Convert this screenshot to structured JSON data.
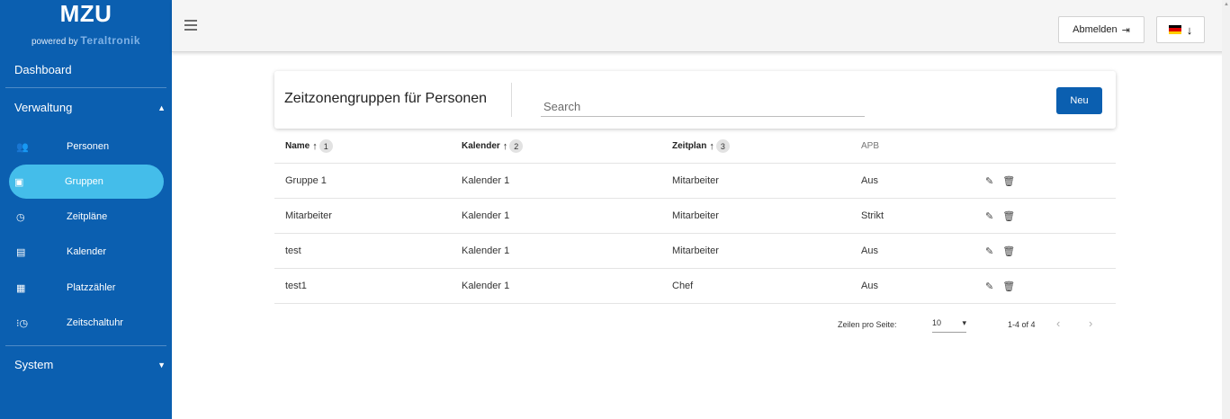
{
  "logo": {
    "title": "MZU",
    "powered_by": "powered by",
    "brand": "Teraltronik"
  },
  "sidebar": {
    "dashboard": "Dashboard",
    "verwaltung": "Verwaltung",
    "items": [
      {
        "label": "Personen",
        "icon": "persons-icon",
        "glyph": "👥"
      },
      {
        "label": "Gruppen",
        "icon": "group-icon",
        "glyph": "▣"
      },
      {
        "label": "Zeitpläne",
        "icon": "clock-icon",
        "glyph": "◷"
      },
      {
        "label": "Kalender",
        "icon": "calendar-icon",
        "glyph": "▤"
      },
      {
        "label": "Platzzähler",
        "icon": "counter-icon",
        "glyph": "▦"
      },
      {
        "label": "Zeitschaltuhr",
        "icon": "timer-icon",
        "glyph": "⁝◷"
      }
    ],
    "system": "System",
    "active_color": "#44bdea",
    "bg_color": "#0b5fb0"
  },
  "topbar": {
    "logout": "Abmelden",
    "logout_icon": "⇥",
    "lang_arrow": "↓"
  },
  "card": {
    "title": "Zeitzonengruppen für Personen",
    "search_placeholder": "Search",
    "new_button": "Neu"
  },
  "table": {
    "headers": [
      "Name",
      "Kalender",
      "Zeitplan",
      "APB"
    ],
    "sort_badges": [
      "1",
      "2",
      "3"
    ],
    "sort_arrow": "↑",
    "rows": [
      {
        "name": "Gruppe 1",
        "kalender": "Kalender 1",
        "zeitplan": "Mitarbeiter",
        "apb": "Aus"
      },
      {
        "name": "Mitarbeiter",
        "kalender": "Kalender 1",
        "zeitplan": "Mitarbeiter",
        "apb": "Strikt"
      },
      {
        "name": "test",
        "kalender": "Kalender 1",
        "zeitplan": "Mitarbeiter",
        "apb": "Aus"
      },
      {
        "name": "test1",
        "kalender": "Kalender 1",
        "zeitplan": "Chef",
        "apb": "Aus"
      }
    ],
    "edit_glyph": "✎",
    "delete_glyph": "🗑"
  },
  "pagination": {
    "rows_label": "Zeilen pro Seite:",
    "rows_value": "10",
    "range": "1-4 of 4",
    "prev": "‹",
    "next": "›"
  }
}
